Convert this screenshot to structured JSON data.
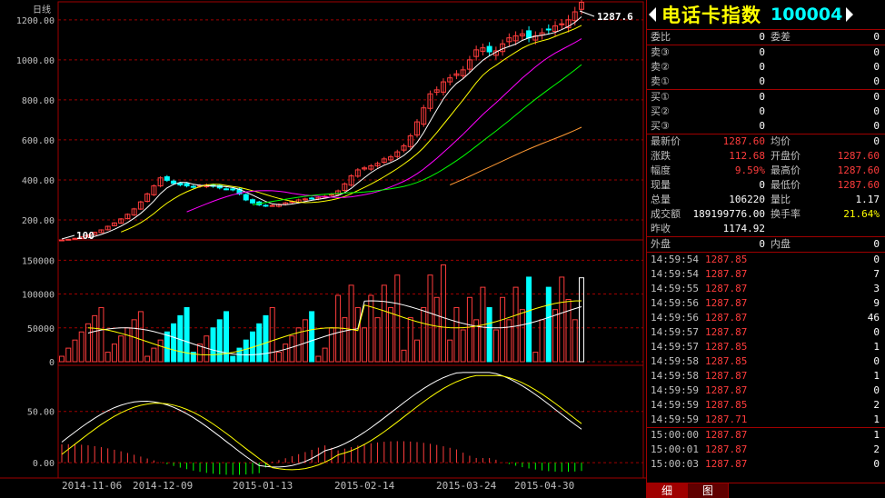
{
  "chart": {
    "period_label": "日线",
    "last_price_marker": "1287.6",
    "low_marker": "100",
    "price_ticks": [
      "1200.00",
      "1000.00",
      "800.00",
      "600.00",
      "400.00",
      "200.00"
    ],
    "volume_ticks": [
      "150000",
      "100000",
      "50000",
      "0"
    ],
    "macd_ticks": [
      "50.00",
      "0.00"
    ],
    "dates": [
      "2014-11-06",
      "2014-12-09",
      "2015-01-13",
      "2015-02-14",
      "2015-03-24",
      "2015-04-30"
    ],
    "colors": {
      "up": "#ff3c3c",
      "down": "#00ffff",
      "ma5": "#ffffff",
      "ma10": "#ffff00",
      "ma20": "#ff00ff",
      "ma30": "#00ff00",
      "ma60": "#ff9933",
      "grid": "#a00000"
    }
  },
  "chart_data": {
    "type": "candlestick",
    "price_ylim": [
      100,
      1290
    ],
    "close_series": [
      100,
      103,
      108,
      115,
      125,
      138,
      150,
      168,
      185,
      205,
      228,
      255,
      290,
      330,
      370,
      410,
      398,
      382,
      375,
      370,
      365,
      372,
      375,
      368,
      360,
      355,
      350,
      330,
      300,
      285,
      275,
      270,
      272,
      278,
      285,
      292,
      300,
      305,
      308,
      312,
      318,
      328,
      345,
      380,
      420,
      450,
      460,
      470,
      482,
      505,
      515,
      540,
      570,
      620,
      690,
      760,
      830,
      850,
      890,
      910,
      930,
      950,
      1000,
      1050,
      1060,
      1040,
      1045,
      1080,
      1110,
      1120,
      1130,
      1110,
      1120,
      1135,
      1150,
      1170,
      1180,
      1200,
      1240,
      1287.6
    ],
    "volume_ylim": [
      0,
      180000
    ],
    "macd_ylim": [
      -15,
      95
    ]
  },
  "panel": {
    "name": "电话卡指数",
    "code": "100004",
    "weibi_label": "委比",
    "weibi_val": "0",
    "weicha_label": "委差",
    "weicha_val": "0",
    "asks": [
      {
        "l": "卖③",
        "p": "0",
        "v": "0"
      },
      {
        "l": "卖②",
        "p": "0",
        "v": "0"
      },
      {
        "l": "卖①",
        "p": "0",
        "v": "0"
      }
    ],
    "bids": [
      {
        "l": "买①",
        "p": "0",
        "v": "0"
      },
      {
        "l": "买②",
        "p": "0",
        "v": "0"
      },
      {
        "l": "买③",
        "p": "0",
        "v": "0"
      }
    ],
    "stats": [
      {
        "l1": "最新价",
        "v1": "1287.60",
        "c1": "red",
        "l2": "均价",
        "v2": "0",
        "c2": "wht"
      },
      {
        "l1": "涨跌",
        "v1": "112.68",
        "c1": "red",
        "l2": "开盘价",
        "v2": "1287.60",
        "c2": "red"
      },
      {
        "l1": "幅度",
        "v1": "9.59%",
        "c1": "red",
        "l2": "最高价",
        "v2": "1287.60",
        "c2": "red"
      },
      {
        "l1": "现量",
        "v1": "0",
        "c1": "wht",
        "l2": "最低价",
        "v2": "1287.60",
        "c2": "red"
      },
      {
        "l1": "总量",
        "v1": "106220",
        "c1": "wht",
        "l2": "量比",
        "v2": "1.17",
        "c2": "wht"
      },
      {
        "l1": "成交额",
        "v1": "189199776.00",
        "c1": "wht",
        "l2": "换手率",
        "v2": "21.64%",
        "c2": "yel"
      },
      {
        "l1": "昨收",
        "v1": "1174.92",
        "c1": "wht",
        "l2": "",
        "v2": "",
        "c2": "wht"
      }
    ],
    "waipan_label": "外盘",
    "waipan_val": "0",
    "neipan_label": "内盘",
    "neipan_val": "0",
    "ticks": [
      {
        "t": "14:59:54",
        "p": "1287.85",
        "v": "0"
      },
      {
        "t": "14:59:54",
        "p": "1287.87",
        "v": "7"
      },
      {
        "t": "14:59:55",
        "p": "1287.87",
        "v": "3"
      },
      {
        "t": "14:59:56",
        "p": "1287.87",
        "v": "9"
      },
      {
        "t": "14:59:56",
        "p": "1287.87",
        "v": "46"
      },
      {
        "t": "14:59:57",
        "p": "1287.87",
        "v": "0"
      },
      {
        "t": "14:59:57",
        "p": "1287.85",
        "v": "1"
      },
      {
        "t": "14:59:58",
        "p": "1287.85",
        "v": "0"
      },
      {
        "t": "14:59:58",
        "p": "1287.87",
        "v": "1"
      },
      {
        "t": "14:59:59",
        "p": "1287.87",
        "v": "0"
      },
      {
        "t": "14:59:59",
        "p": "1287.85",
        "v": "2"
      },
      {
        "t": "14:59:59",
        "p": "1287.71",
        "v": "1"
      },
      {
        "t": "15:00:00",
        "p": "1287.87",
        "v": "1"
      },
      {
        "t": "15:00:01",
        "p": "1287.87",
        "v": "2"
      },
      {
        "t": "15:00:03",
        "p": "1287.87",
        "v": "0"
      }
    ],
    "tab_detail": "细",
    "tab_chart": "图"
  }
}
